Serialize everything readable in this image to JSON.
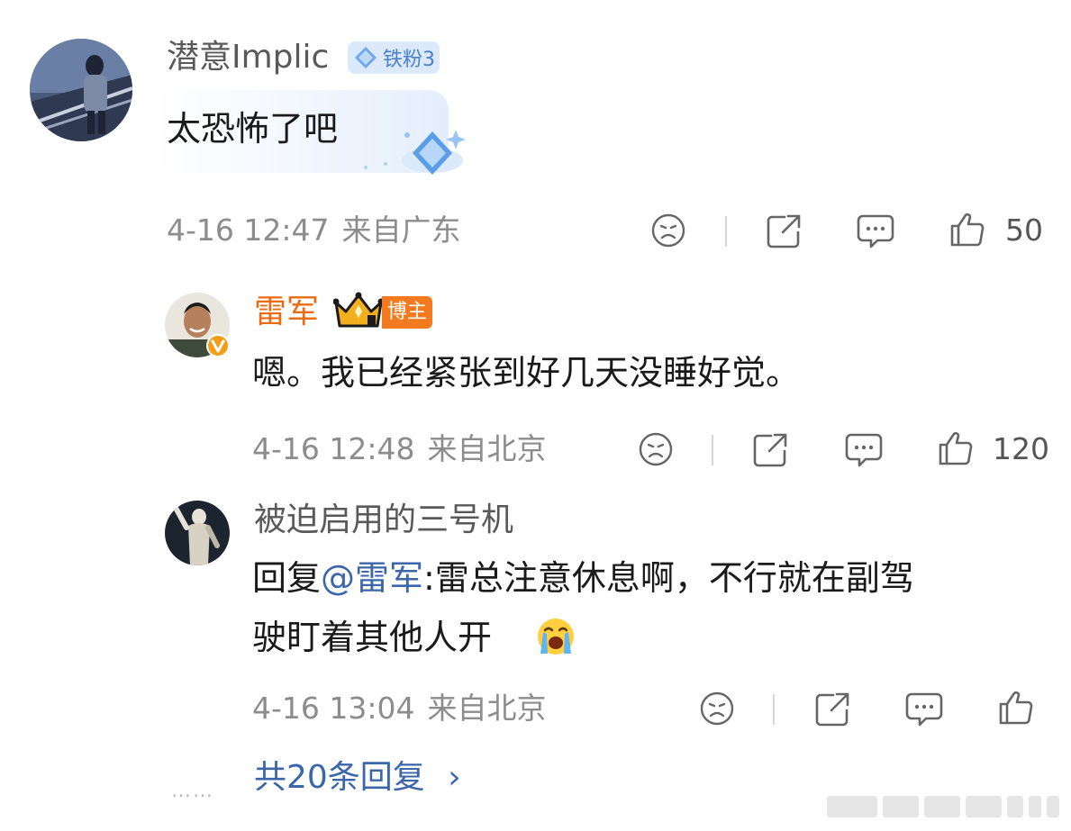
{
  "comments": [
    {
      "user": "潜意Implic",
      "badge_label": "铁粉3",
      "text": "太恐怖了吧",
      "time": "4-16 12:47",
      "location": "来自广东",
      "likes": "50"
    },
    {
      "user": "雷军",
      "badge_label": "博主",
      "text": "嗯。我已经紧张到好几天没睡好觉。",
      "time": "4-16 12:48",
      "location": "来自北京",
      "likes": "120"
    },
    {
      "user": "被迫启用的三号机",
      "reply_prefix": "回复",
      "mention": "@雷军",
      "text_line1": ":雷总注意休息啊，不行就在副驾",
      "text_line2": "驶盯着其他人开",
      "emoji": "crying-face",
      "time": "4-16 13:04",
      "location": "来自北京",
      "likes": ""
    }
  ],
  "more_replies": {
    "dots": "……",
    "label": "共20条回复",
    "arrow": "›"
  },
  "colors": {
    "link": "#3b66a9",
    "author_orange": "#ea6b12",
    "meta_gray": "#8c8c8c"
  }
}
